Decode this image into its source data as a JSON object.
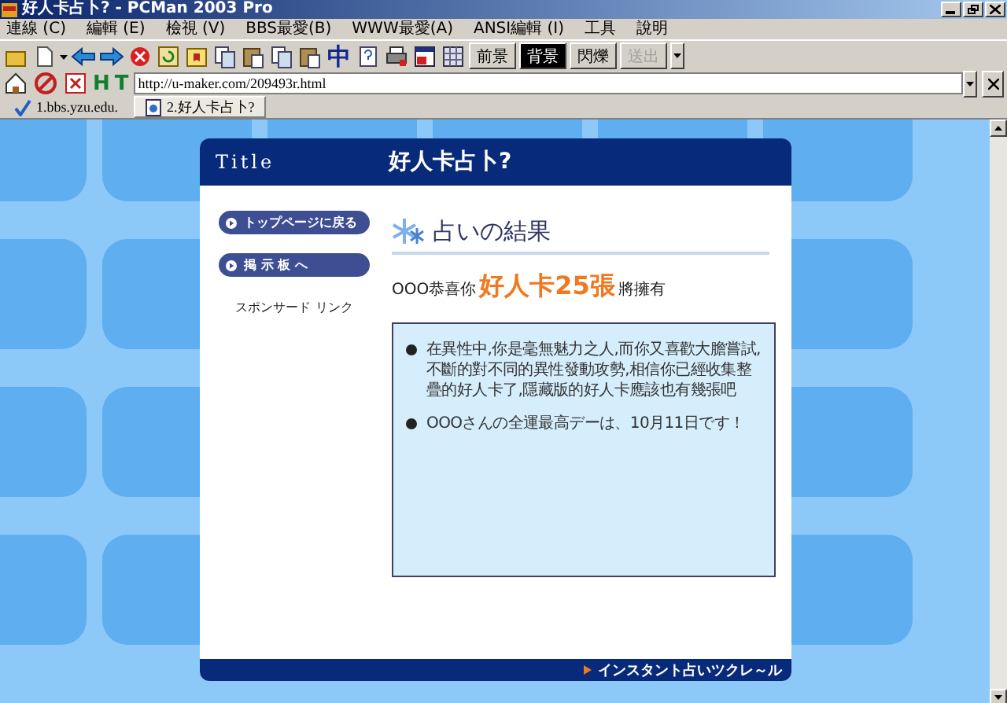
{
  "window": {
    "title": "好人卡占卜? - PCMan 2003 Pro"
  },
  "menu": [
    "連線 (C)",
    "編輯 (E)",
    "檢視 (V)",
    "BBS最愛(B)",
    "WWW最愛(A)",
    "ANSI編輯 (I)",
    "工具",
    "說明"
  ],
  "toolbar": {
    "glyph": "中",
    "text_buttons": [
      {
        "label": "前景",
        "selected": false,
        "disabled": false
      },
      {
        "label": "背景",
        "selected": true,
        "disabled": false
      },
      {
        "label": "閃爍",
        "selected": false,
        "disabled": false
      },
      {
        "label": "送出",
        "selected": false,
        "disabled": true
      }
    ]
  },
  "address_bar": {
    "glyphs": [
      "H",
      "T"
    ],
    "url": "http://u-maker.com/209493r.html"
  },
  "tabs": [
    {
      "label": "1.bbs.yzu.edu.",
      "selected": false
    },
    {
      "label": "2.好人卡占卜?",
      "selected": true
    }
  ],
  "page": {
    "logo": "Title",
    "heading": "好人卡占卜?",
    "nav_buttons": [
      "トップページに戻る",
      "掲 示 板 へ"
    ],
    "sponsor": "スポンサード リンク",
    "section_title": "占いの結果",
    "result": {
      "prefix": "OOO恭喜你",
      "highlight": "好人卡25張",
      "suffix": "將擁有"
    },
    "bullets": [
      "在異性中,你是毫無魅力之人,而你又喜歡大膽嘗試,不斷的對不同的異性發動攻勢,相信你已經收集整疊的好人卡了,隱藏版的好人卡應該也有幾張吧",
      "OOOさんの全運最高デーは、10月11日です！"
    ],
    "footer_link": "インスタント占いツクレ～ル"
  }
}
